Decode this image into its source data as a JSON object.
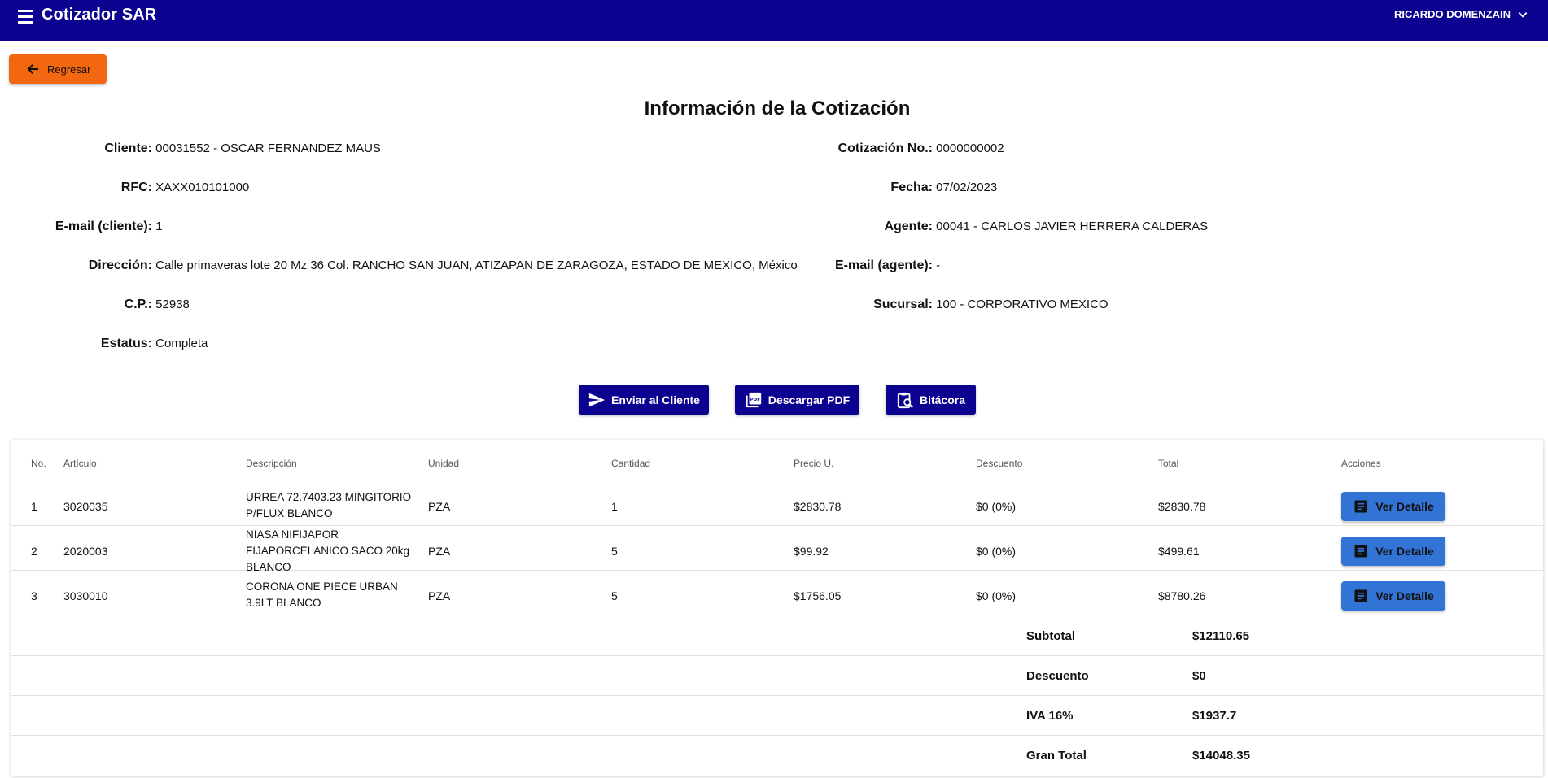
{
  "app": {
    "title": "Cotizador SAR",
    "user": "RICARDO DOMENZAIN",
    "colors": {
      "appbar": "#0b0290",
      "back_button": "#f26710",
      "detail_button": "#3274d6"
    }
  },
  "back_button": {
    "label": "Regresar",
    "icon": "arrow-left-icon"
  },
  "page": {
    "heading": "Información de la Cotización"
  },
  "client_info": {
    "cliente": {
      "label": "Cliente:",
      "value": "00031552 - OSCAR FERNANDEZ MAUS"
    },
    "rfc": {
      "label": "RFC:",
      "value": "XAXX010101000"
    },
    "email": {
      "label": "E-mail (cliente):",
      "value": "1"
    },
    "direccion": {
      "label": "Dirección:",
      "value": "Calle primaveras lote 20 Mz 36 Col. RANCHO SAN JUAN, ATIZAPAN DE ZARAGOZA, ESTADO DE MEXICO, México"
    },
    "cp": {
      "label": "C.P.:",
      "value": "52938"
    },
    "estatus": {
      "label": "Estatus:",
      "value": "Completa"
    }
  },
  "quote_info": {
    "numero": {
      "label": "Cotización No.:",
      "value": "0000000002"
    },
    "fecha": {
      "label": "Fecha:",
      "value": "07/02/2023"
    },
    "agente": {
      "label": "Agente:",
      "value": "00041 - CARLOS JAVIER HERRERA CALDERAS"
    },
    "email_agente": {
      "label": "E-mail (agente):",
      "value": "-"
    },
    "sucursal": {
      "label": "Sucursal:",
      "value": "100 - CORPORATIVO MEXICO"
    }
  },
  "actions": {
    "enviar": {
      "label": "Enviar al Cliente",
      "icon": "send-icon"
    },
    "pdf": {
      "label": "Descargar PDF",
      "icon": "pdf-icon"
    },
    "bitacora": {
      "label": "Bitácora",
      "icon": "clipboard-search-icon"
    }
  },
  "table": {
    "headers": [
      "No.",
      "Artículo",
      "Descripción",
      "Unidad",
      "Cantidad",
      "Precio U.",
      "Descuento",
      "Total",
      "Acciones"
    ],
    "rows": [
      {
        "no": "1",
        "articulo": "3020035",
        "descripcion": "URREA 72.7403.23 MINGITORIO P/FLUX BLANCO",
        "unidad": "PZA",
        "cantidad": "1",
        "precio": "$2830.78",
        "descuento": "$0 (0%)",
        "total": "$2830.78",
        "accion": "Ver Detalle"
      },
      {
        "no": "2",
        "articulo": "2020003",
        "descripcion": "NIASA NIFIJAPOR FIJAPORCELANICO SACO 20kg BLANCO",
        "unidad": "PZA",
        "cantidad": "5",
        "precio": "$99.92",
        "descuento": "$0 (0%)",
        "total": "$499.61",
        "accion": "Ver Detalle"
      },
      {
        "no": "3",
        "articulo": "3030010",
        "descripcion": "CORONA ONE PIECE URBAN 3.9LT BLANCO",
        "unidad": "PZA",
        "cantidad": "5",
        "precio": "$1756.05",
        "descuento": "$0 (0%)",
        "total": "$8780.26",
        "accion": "Ver Detalle"
      }
    ]
  },
  "summary": {
    "subtotal": {
      "label": "Subtotal",
      "value": "$12110.65"
    },
    "descuento": {
      "label": "Descuento",
      "value": "$0"
    },
    "iva": {
      "label": "IVA 16%",
      "value": "$1937.7"
    },
    "gran_total": {
      "label": "Gran Total",
      "value": "$14048.35"
    }
  }
}
